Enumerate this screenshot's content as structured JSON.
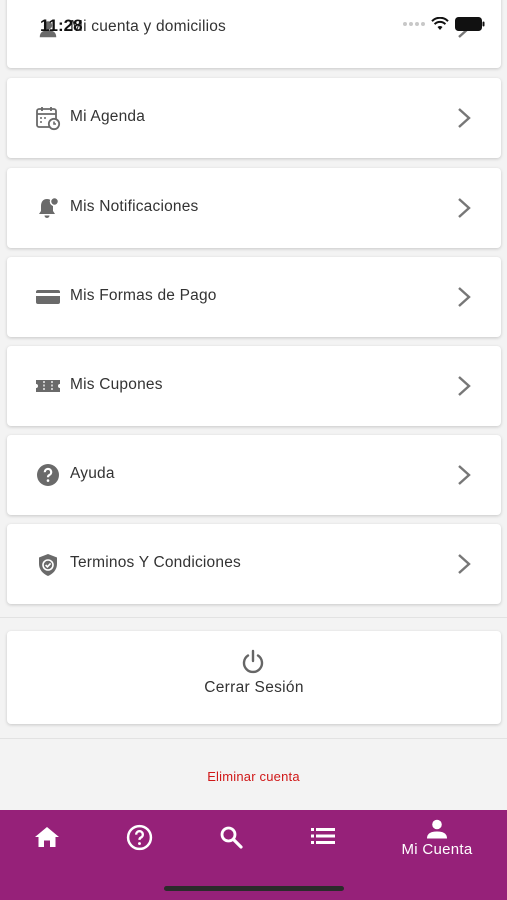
{
  "status_bar": {
    "time": "11:28"
  },
  "menu": {
    "items": [
      {
        "label": "Mi cuenta y domicilios",
        "icon": "person-icon"
      },
      {
        "label": "Mi Agenda",
        "icon": "calendar-clock-icon"
      },
      {
        "label": "Mis Notificaciones",
        "icon": "bell-icon"
      },
      {
        "label": "Mis Formas de Pago",
        "icon": "credit-card-icon"
      },
      {
        "label": "Mis Cupones",
        "icon": "coupon-icon"
      },
      {
        "label": "Ayuda",
        "icon": "help-icon"
      },
      {
        "label": "Terminos Y Condiciones",
        "icon": "shield-check-icon"
      }
    ]
  },
  "logout": {
    "label": "Cerrar Sesión",
    "icon": "power-icon"
  },
  "delete_account": {
    "label": "Eliminar cuenta",
    "color": "#d01818"
  },
  "bottom_nav": {
    "background": "#962179",
    "items": [
      {
        "icon": "home-icon",
        "label": ""
      },
      {
        "icon": "help-circle-icon",
        "label": ""
      },
      {
        "icon": "search-icon",
        "label": ""
      },
      {
        "icon": "list-icon",
        "label": ""
      },
      {
        "icon": "account-icon",
        "label": "Mi Cuenta",
        "active": true
      }
    ]
  }
}
